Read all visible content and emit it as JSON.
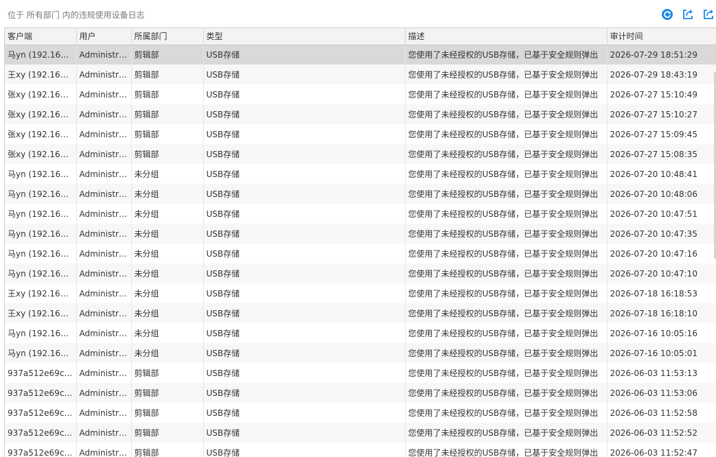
{
  "header": {
    "breadcrumb": "位于 所有部门 内的违规使用设备日志"
  },
  "toolbar": {
    "refresh_color": "#1e88e5",
    "export_color": "#1e88e5"
  },
  "table": {
    "columns": [
      "客户端",
      "用户",
      "所属部门",
      "类型",
      "描述",
      "审计时间"
    ],
    "rows": [
      [
        "马yn (192.168.3...",
        "Administra...",
        "剪辑部",
        "USB存储",
        "您使用了未经授权的USB存储，已基于安全规则弹出",
        "2026-07-29 18:51:29"
      ],
      [
        "王xy (192.168.3...",
        "Administra...",
        "剪辑部",
        "USB存储",
        "您使用了未经授权的USB存储，已基于安全规则弹出",
        "2026-07-29 18:43:19"
      ],
      [
        "张xy (192.168.3...",
        "Administra...",
        "剪辑部",
        "USB存储",
        "您使用了未经授权的USB存储，已基于安全规则弹出",
        "2026-07-27 15:10:49"
      ],
      [
        "张xy (192.168.3...",
        "Administra...",
        "剪辑部",
        "USB存储",
        "您使用了未经授权的USB存储，已基于安全规则弹出",
        "2026-07-27 15:10:27"
      ],
      [
        "张xy (192.168.3...",
        "Administra...",
        "剪辑部",
        "USB存储",
        "您使用了未经授权的USB存储，已基于安全规则弹出",
        "2026-07-27 15:09:45"
      ],
      [
        "张xy (192.168.3...",
        "Administra...",
        "剪辑部",
        "USB存储",
        "您使用了未经授权的USB存储，已基于安全规则弹出",
        "2026-07-27 15:08:35"
      ],
      [
        "马yn (192.168.3...",
        "Administra...",
        "未分组",
        "USB存储",
        "您使用了未经授权的USB存储，已基于安全规则弹出",
        "2026-07-20 10:48:41"
      ],
      [
        "马yn (192.168.3...",
        "Administra...",
        "未分组",
        "USB存储",
        "您使用了未经授权的USB存储，已基于安全规则弹出",
        "2026-07-20 10:48:06"
      ],
      [
        "马yn (192.168.3...",
        "Administra...",
        "未分组",
        "USB存储",
        "您使用了未经授权的USB存储，已基于安全规则弹出",
        "2026-07-20 10:47:51"
      ],
      [
        "马yn (192.168.3...",
        "Administra...",
        "未分组",
        "USB存储",
        "您使用了未经授权的USB存储，已基于安全规则弹出",
        "2026-07-20 10:47:35"
      ],
      [
        "马yn (192.168.3...",
        "Administra...",
        "未分组",
        "USB存储",
        "您使用了未经授权的USB存储，已基于安全规则弹出",
        "2026-07-20 10:47:16"
      ],
      [
        "马yn (192.168.3...",
        "Administra...",
        "未分组",
        "USB存储",
        "您使用了未经授权的USB存储，已基于安全规则弹出",
        "2026-07-20 10:47:10"
      ],
      [
        "王xy (192.168.3...",
        "Administra...",
        "未分组",
        "USB存储",
        "您使用了未经授权的USB存储，已基于安全规则弹出",
        "2026-07-18 16:18:53"
      ],
      [
        "王xy (192.168.3...",
        "Administra...",
        "未分组",
        "USB存储",
        "您使用了未经授权的USB存储，已基于安全规则弹出",
        "2026-07-18 16:18:10"
      ],
      [
        "马yn (192.168.3...",
        "Administra...",
        "未分组",
        "USB存储",
        "您使用了未经授权的USB存储，已基于安全规则弹出",
        "2026-07-16 10:05:16"
      ],
      [
        "马yn (192.168.3...",
        "Administra...",
        "未分组",
        "USB存储",
        "您使用了未经授权的USB存储，已基于安全规则弹出",
        "2026-07-16 10:05:01"
      ],
      [
        "937a512e69c5f...",
        "Administra...",
        "剪辑部",
        "USB存储",
        "您使用了未经授权的USB存储，已基于安全规则弹出",
        "2026-06-03 11:53:13"
      ],
      [
        "937a512e69c5f...",
        "Administra...",
        "剪辑部",
        "USB存储",
        "您使用了未经授权的USB存储，已基于安全规则弹出",
        "2026-06-03 11:53:06"
      ],
      [
        "937a512e69c5f...",
        "Administra...",
        "剪辑部",
        "USB存储",
        "您使用了未经授权的USB存储，已基于安全规则弹出",
        "2026-06-03 11:52:58"
      ],
      [
        "937a512e69c5f...",
        "Administra...",
        "剪辑部",
        "USB存储",
        "您使用了未经授权的USB存储，已基于安全规则弹出",
        "2026-06-03 11:52:52"
      ],
      [
        "937a512e69c5f...",
        "Administra...",
        "剪辑部",
        "USB存储",
        "您使用了未经授权的USB存储，已基于安全规则弹出",
        "2026-06-03 11:52:47"
      ]
    ]
  }
}
